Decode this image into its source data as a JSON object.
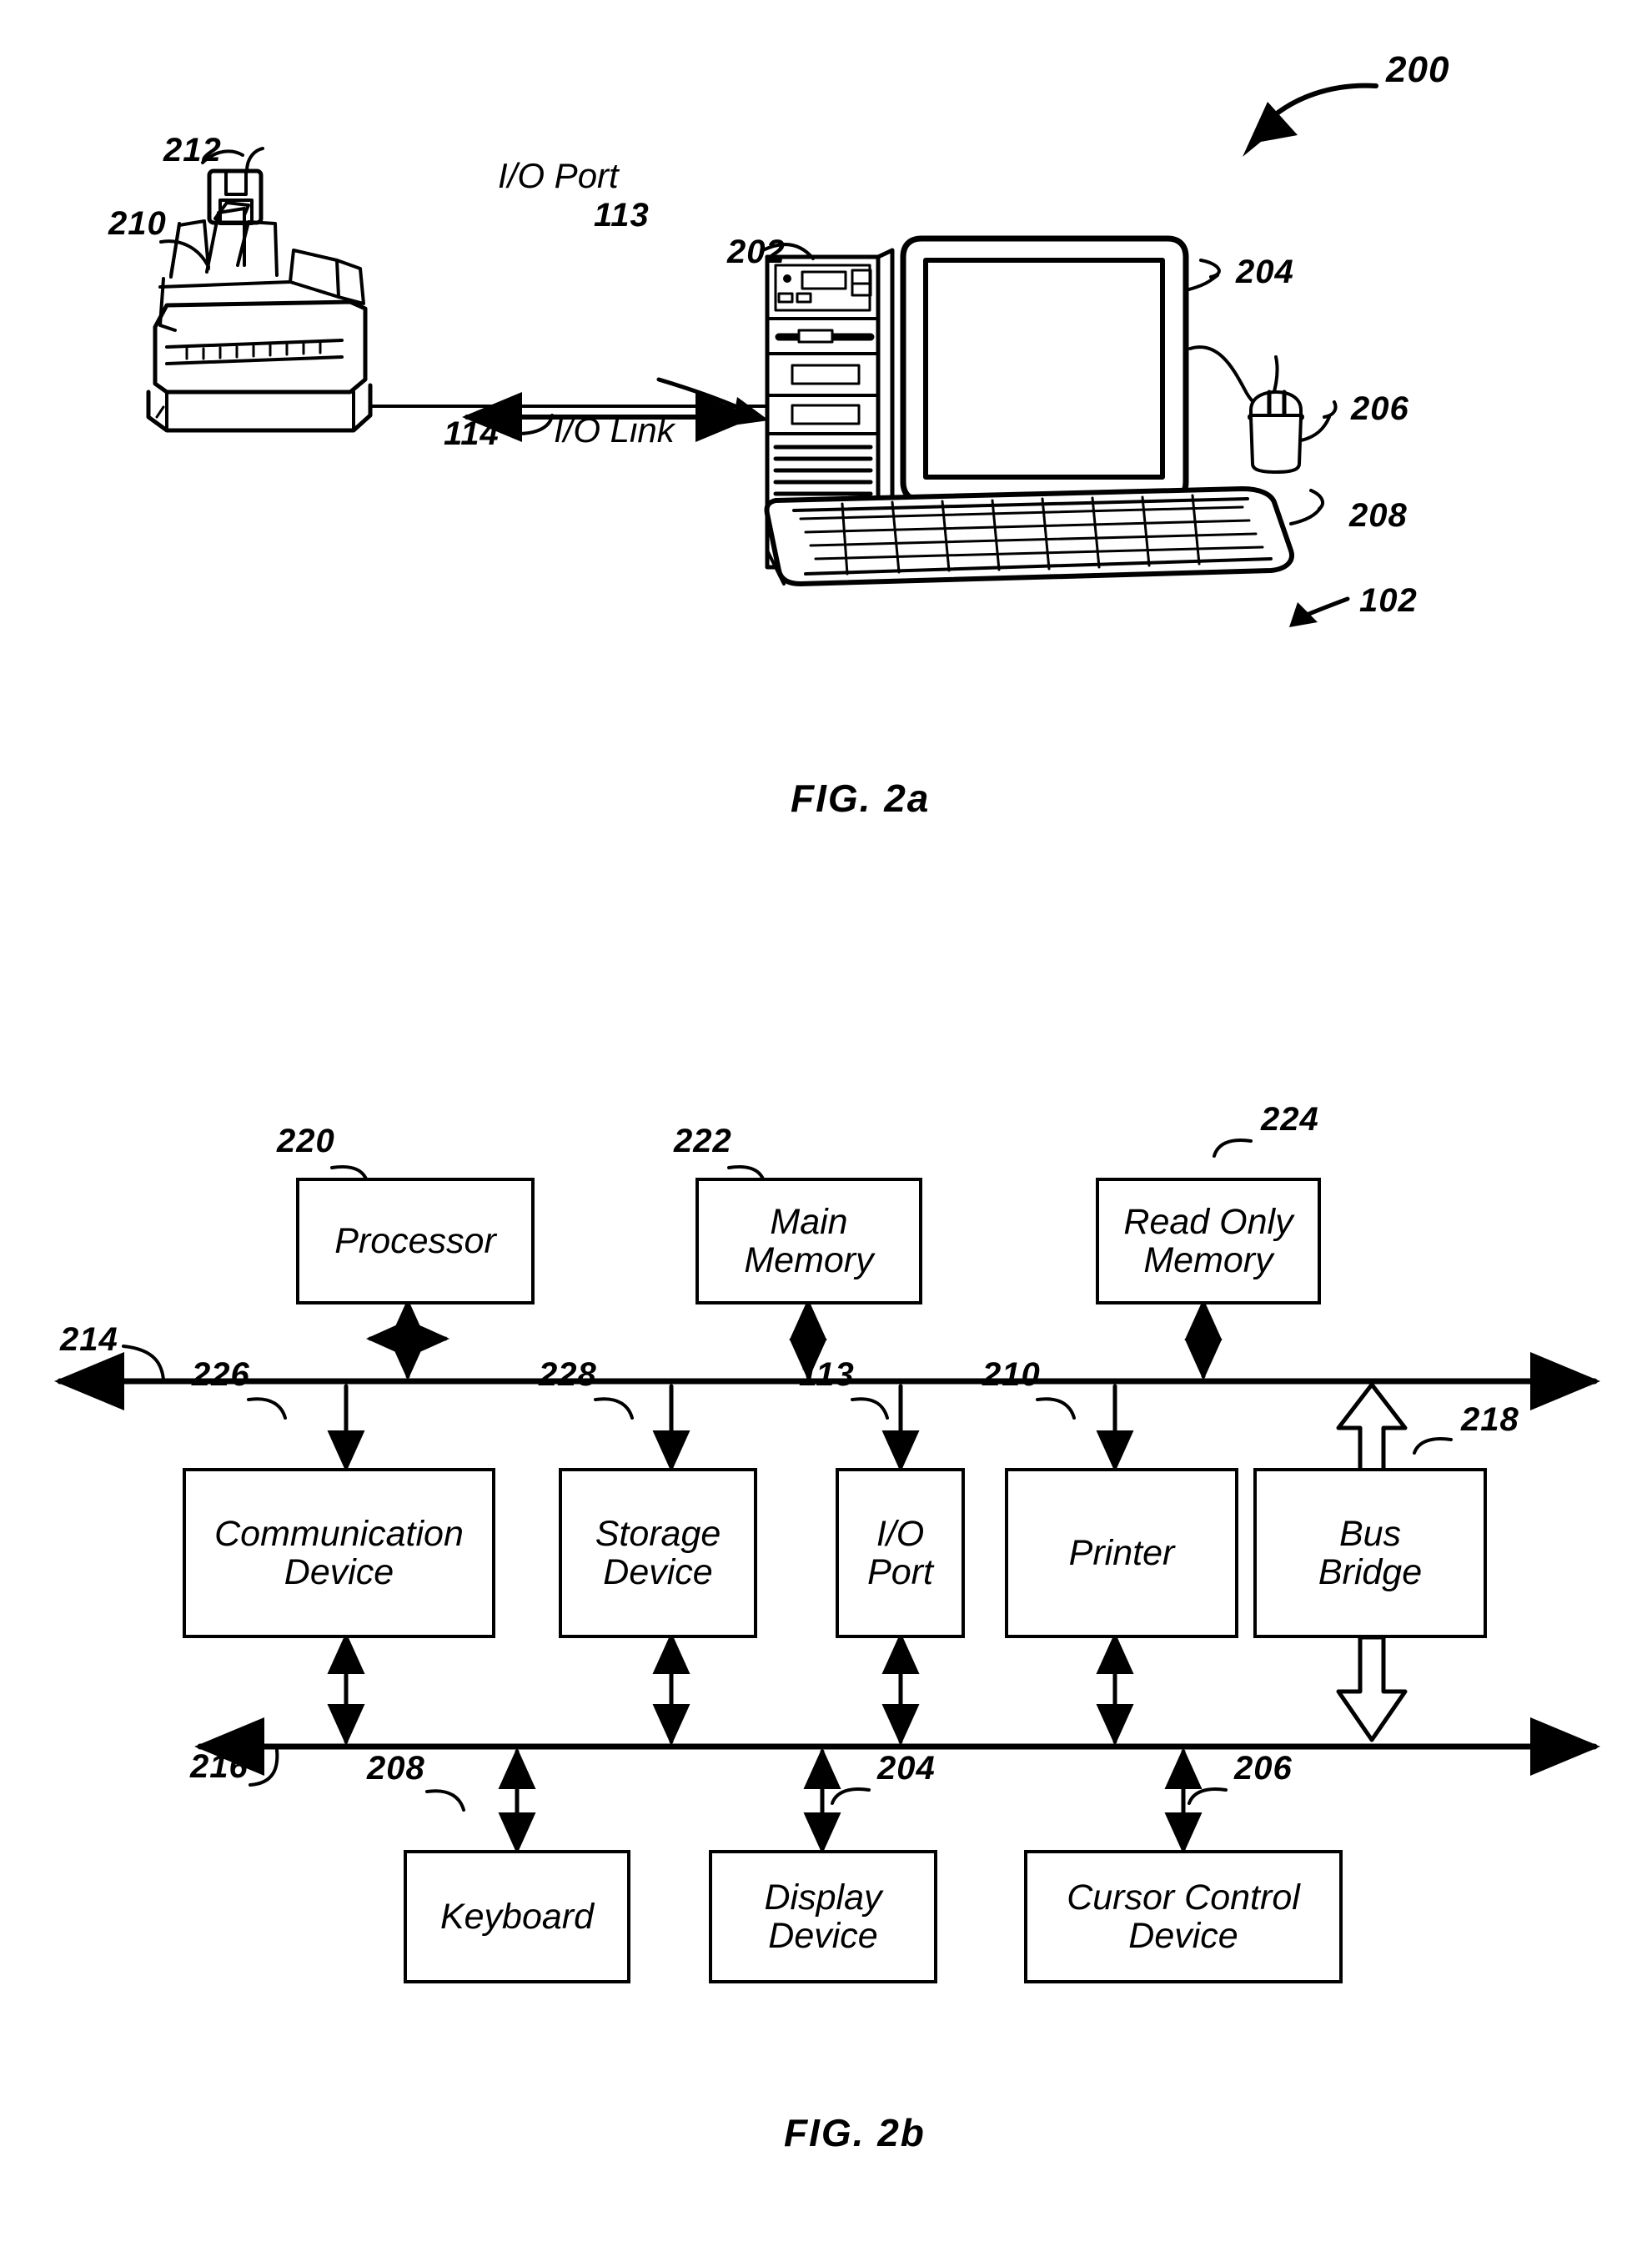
{
  "figure": {
    "sheet_title": "FIG. 2a / FIG. 2b",
    "fig_2a_caption": "FIG. 2a",
    "fig_2b_caption": "FIG. 2b"
  },
  "fig2a": {
    "system_ref": "200",
    "labels": {
      "io_port_text": "I/O Port",
      "io_port_ref": "113",
      "io_link_text": "I/O Link",
      "io_link_ref": "114",
      "floppy_ref": "212",
      "printer_ref": "210",
      "tower_ref": "202",
      "monitor_ref": "204",
      "mouse_ref": "206",
      "keyboard_ref": "208",
      "computer_ref": "102"
    }
  },
  "fig2b": {
    "bus_upper_ref": "214",
    "bus_lower_ref": "216",
    "bus_bridge_ref": "218",
    "top_row": [
      {
        "ref": "220",
        "lines": [
          "Processor"
        ]
      },
      {
        "ref": "222",
        "lines": [
          "Main",
          "Memory"
        ]
      },
      {
        "ref": "224",
        "lines": [
          "Read Only",
          "Memory"
        ]
      }
    ],
    "middle_row": [
      {
        "ref": "226",
        "lines": [
          "Communication",
          "Device"
        ]
      },
      {
        "ref": "228",
        "lines": [
          "Storage",
          "Device"
        ]
      },
      {
        "ref": "113",
        "lines": [
          "I/O",
          "Port"
        ]
      },
      {
        "ref": "210",
        "lines": [
          "Printer"
        ]
      },
      {
        "ref": "218",
        "lines": [
          "Bus",
          "Bridge"
        ]
      }
    ],
    "bottom_row": [
      {
        "ref": "208",
        "lines": [
          "Keyboard"
        ]
      },
      {
        "ref": "204",
        "lines": [
          "Display",
          "Device"
        ]
      },
      {
        "ref": "206",
        "lines": [
          "Cursor Control",
          "Device"
        ]
      }
    ]
  },
  "colors": {
    "ink": "#000000",
    "paper": "#ffffff"
  }
}
